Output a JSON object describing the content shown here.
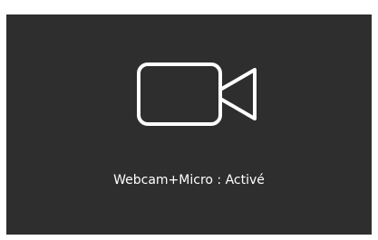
{
  "osd": {
    "icon": "video-camera-icon",
    "status_label": "Webcam+Micro : Activé"
  },
  "colors": {
    "panel_background": "#2e2e2e",
    "foreground": "#ffffff"
  }
}
